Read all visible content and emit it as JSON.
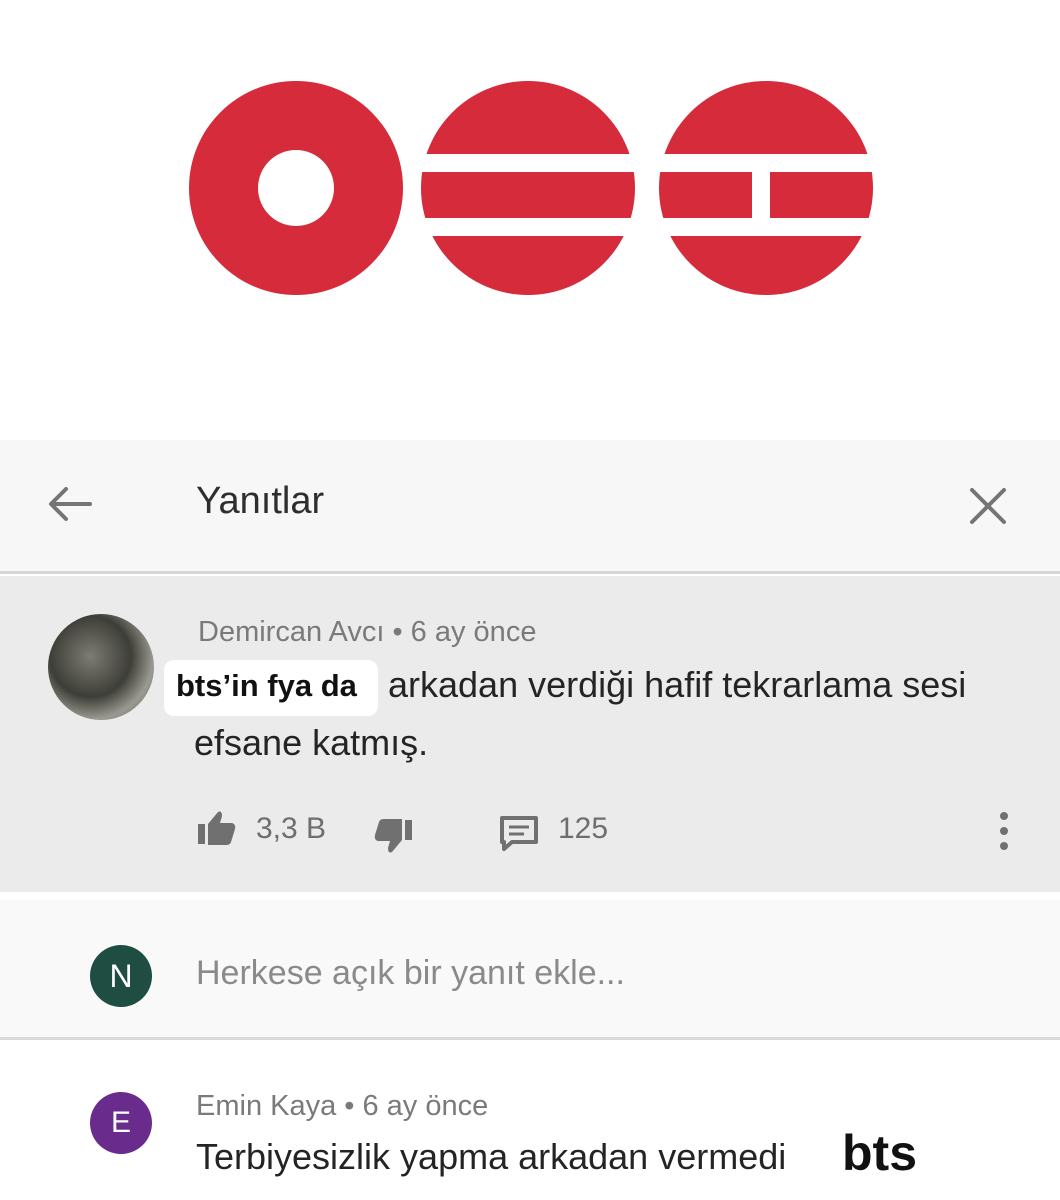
{
  "colors": {
    "logo_red": "#d52b3a",
    "avatar_n": "#1f4d42",
    "avatar_e": "#6a2c8c"
  },
  "logo": {
    "icon": "three-red-circle-logo"
  },
  "header": {
    "title": "Yanıtlar",
    "back_icon": "arrow-left-icon",
    "close_icon": "close-icon"
  },
  "comment": {
    "meta": "Demircan Avcı • 6 ay önce",
    "highlight": "bts’in fya da",
    "line1": "arkadan verdiği hafif tekrarlama sesi",
    "line2": "efsane katmış.",
    "likes": "3,3 B",
    "replies": "125"
  },
  "add_reply": {
    "avatar_letter": "N",
    "placeholder": "Herkese açık bir yanıt ekle..."
  },
  "reply": {
    "avatar_letter": "E",
    "meta": "Emin Kaya • 6 ay önce",
    "text": "Terbiyesizlik yapma arkadan vermedi",
    "tag": "bts"
  }
}
